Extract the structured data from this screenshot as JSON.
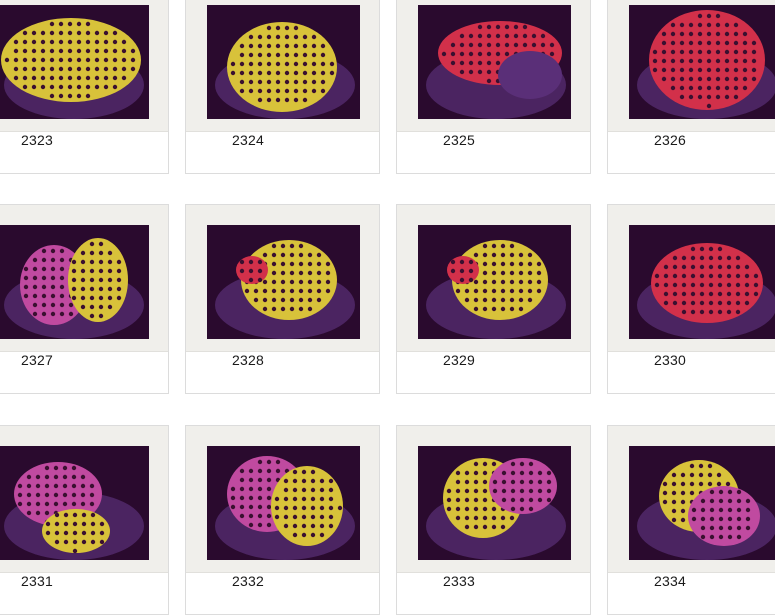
{
  "gallery": {
    "items": [
      {
        "label": "2323",
        "coral": "yellow-polyps"
      },
      {
        "label": "2324",
        "coral": "yellow-polyps"
      },
      {
        "label": "2325",
        "coral": "red-polyps"
      },
      {
        "label": "2326",
        "coral": "red-polyps"
      },
      {
        "label": "2327",
        "coral": "mixed-polyps"
      },
      {
        "label": "2328",
        "coral": "mixed-polyps"
      },
      {
        "label": "2329",
        "coral": "mixed-polyps"
      },
      {
        "label": "2330",
        "coral": "red-polyps"
      },
      {
        "label": "2331",
        "coral": "mixed-polyps"
      },
      {
        "label": "2332",
        "coral": "mixed-polyps"
      },
      {
        "label": "2333",
        "coral": "mixed-polyps"
      },
      {
        "label": "2334",
        "coral": "mixed-polyps"
      }
    ]
  },
  "colors": {
    "photo_background": "#2a0a2e",
    "rock": "#5a2f78",
    "polyp_yellow": "#d8c23a",
    "polyp_red": "#d2304a",
    "polyp_pink": "#c04aa0",
    "polyp_center": "#3a1030"
  }
}
